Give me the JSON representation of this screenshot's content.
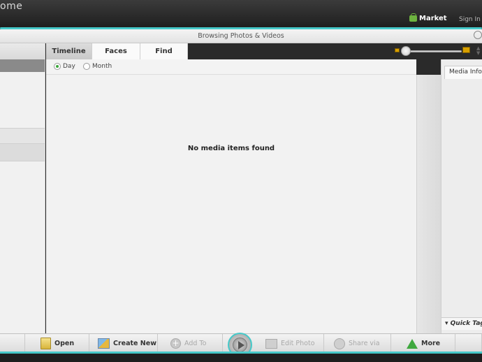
{
  "window": {
    "title": "ome"
  },
  "header": {
    "market_label": "Market",
    "signin_label": "Sign In",
    "accent_color": "#46c9c9"
  },
  "browse": {
    "title": "Browsing Photos & Videos"
  },
  "tabs": [
    {
      "label": "Timeline",
      "active": true
    },
    {
      "label": "Faces",
      "active": false
    },
    {
      "label": "Find",
      "active": false
    }
  ],
  "view_mode": {
    "options": [
      {
        "label": "Day",
        "selected": true
      },
      {
        "label": "Month",
        "selected": false
      }
    ]
  },
  "main": {
    "empty_message": "No media items found"
  },
  "right_panel": {
    "tab_label": "Media Info",
    "quick_tag_label": "Quick Tag"
  },
  "toolbar": {
    "open_label": "Open",
    "create_new_label": "Create New",
    "add_to_label": "Add To",
    "edit_photo_label": "Edit Photo",
    "share_via_label": "Share via",
    "more_label": "More"
  },
  "icons": {
    "search": "search-icon",
    "market": "shopping-bag-icon",
    "zoom_small": "small-thumbnail-icon",
    "zoom_large": "large-thumbnail-icon",
    "play": "play-icon"
  }
}
